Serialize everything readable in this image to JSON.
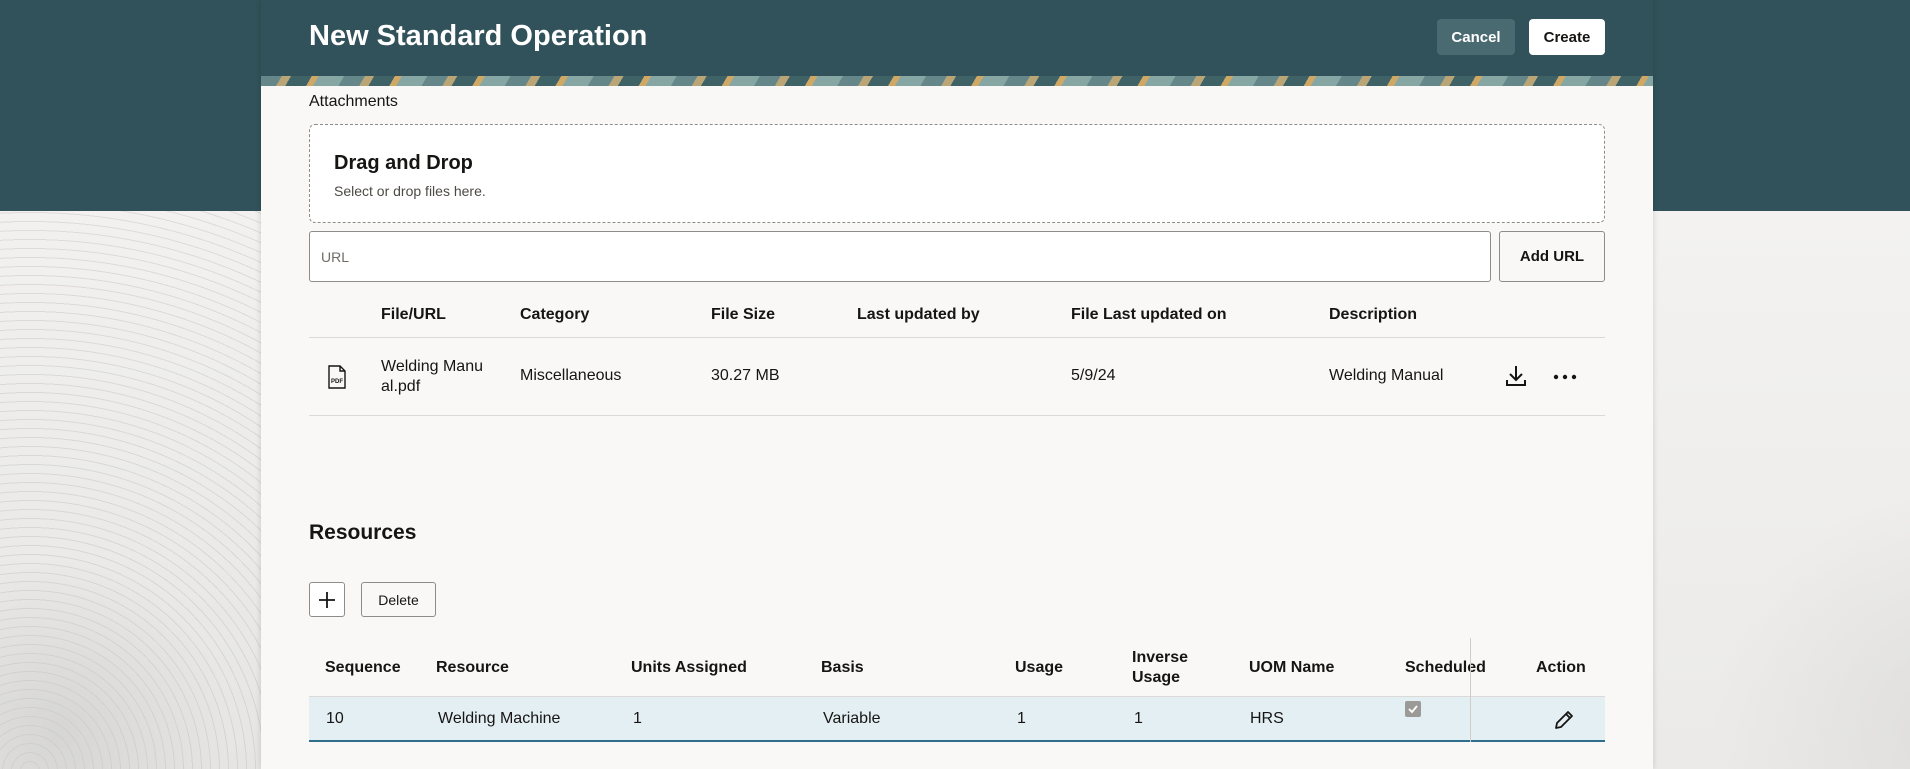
{
  "header": {
    "title": "New Standard Operation",
    "cancel_label": "Cancel",
    "create_label": "Create"
  },
  "attachments": {
    "section_label": "Attachments",
    "dropzone_title": "Drag and Drop",
    "dropzone_subtitle": "Select or drop files here.",
    "url_placeholder": "URL",
    "add_url_label": "Add URL",
    "columns": [
      "File/URL",
      "Category",
      "File Size",
      "Last updated by",
      "File Last updated on",
      "Description"
    ],
    "rows": [
      {
        "file_icon": "pdf-file-icon",
        "file": "Welding Manual.pdf",
        "category": "Miscellaneous",
        "file_size": "30.27 MB",
        "last_updated_by": "",
        "last_updated_on": "5/9/24",
        "description": "Welding Manual"
      }
    ]
  },
  "resources": {
    "title": "Resources",
    "add_icon": "plus-icon",
    "delete_label": "Delete",
    "columns": [
      "Sequence",
      "Resource",
      "Units Assigned",
      "Basis",
      "Usage",
      "Inverse Usage",
      "UOM Name",
      "Scheduled",
      "Action"
    ],
    "rows": [
      {
        "sequence": "10",
        "resource": "Welding Machine",
        "units_assigned": "1",
        "basis": "Variable",
        "usage": "1",
        "inverse_usage": "1",
        "uom_name": "HRS",
        "scheduled": true
      }
    ]
  },
  "colors": {
    "header_bg": "#31525a",
    "panel_bg": "#f9f8f6",
    "selected_row_bg": "#e4eff4",
    "selected_row_border": "#2f6f8b"
  }
}
